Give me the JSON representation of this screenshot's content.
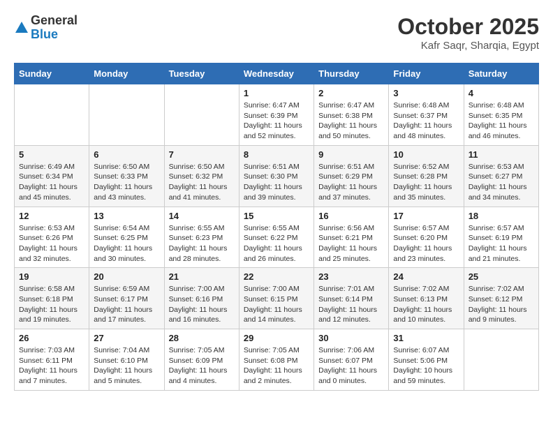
{
  "header": {
    "logo_general": "General",
    "logo_blue": "Blue",
    "month_title": "October 2025",
    "subtitle": "Kafr Saqr, Sharqia, Egypt"
  },
  "weekdays": [
    "Sunday",
    "Monday",
    "Tuesday",
    "Wednesday",
    "Thursday",
    "Friday",
    "Saturday"
  ],
  "weeks": [
    [
      {
        "day": "",
        "content": ""
      },
      {
        "day": "",
        "content": ""
      },
      {
        "day": "",
        "content": ""
      },
      {
        "day": "1",
        "content": "Sunrise: 6:47 AM\nSunset: 6:39 PM\nDaylight: 11 hours\nand 52 minutes."
      },
      {
        "day": "2",
        "content": "Sunrise: 6:47 AM\nSunset: 6:38 PM\nDaylight: 11 hours\nand 50 minutes."
      },
      {
        "day": "3",
        "content": "Sunrise: 6:48 AM\nSunset: 6:37 PM\nDaylight: 11 hours\nand 48 minutes."
      },
      {
        "day": "4",
        "content": "Sunrise: 6:48 AM\nSunset: 6:35 PM\nDaylight: 11 hours\nand 46 minutes."
      }
    ],
    [
      {
        "day": "5",
        "content": "Sunrise: 6:49 AM\nSunset: 6:34 PM\nDaylight: 11 hours\nand 45 minutes."
      },
      {
        "day": "6",
        "content": "Sunrise: 6:50 AM\nSunset: 6:33 PM\nDaylight: 11 hours\nand 43 minutes."
      },
      {
        "day": "7",
        "content": "Sunrise: 6:50 AM\nSunset: 6:32 PM\nDaylight: 11 hours\nand 41 minutes."
      },
      {
        "day": "8",
        "content": "Sunrise: 6:51 AM\nSunset: 6:30 PM\nDaylight: 11 hours\nand 39 minutes."
      },
      {
        "day": "9",
        "content": "Sunrise: 6:51 AM\nSunset: 6:29 PM\nDaylight: 11 hours\nand 37 minutes."
      },
      {
        "day": "10",
        "content": "Sunrise: 6:52 AM\nSunset: 6:28 PM\nDaylight: 11 hours\nand 35 minutes."
      },
      {
        "day": "11",
        "content": "Sunrise: 6:53 AM\nSunset: 6:27 PM\nDaylight: 11 hours\nand 34 minutes."
      }
    ],
    [
      {
        "day": "12",
        "content": "Sunrise: 6:53 AM\nSunset: 6:26 PM\nDaylight: 11 hours\nand 32 minutes."
      },
      {
        "day": "13",
        "content": "Sunrise: 6:54 AM\nSunset: 6:25 PM\nDaylight: 11 hours\nand 30 minutes."
      },
      {
        "day": "14",
        "content": "Sunrise: 6:55 AM\nSunset: 6:23 PM\nDaylight: 11 hours\nand 28 minutes."
      },
      {
        "day": "15",
        "content": "Sunrise: 6:55 AM\nSunset: 6:22 PM\nDaylight: 11 hours\nand 26 minutes."
      },
      {
        "day": "16",
        "content": "Sunrise: 6:56 AM\nSunset: 6:21 PM\nDaylight: 11 hours\nand 25 minutes."
      },
      {
        "day": "17",
        "content": "Sunrise: 6:57 AM\nSunset: 6:20 PM\nDaylight: 11 hours\nand 23 minutes."
      },
      {
        "day": "18",
        "content": "Sunrise: 6:57 AM\nSunset: 6:19 PM\nDaylight: 11 hours\nand 21 minutes."
      }
    ],
    [
      {
        "day": "19",
        "content": "Sunrise: 6:58 AM\nSunset: 6:18 PM\nDaylight: 11 hours\nand 19 minutes."
      },
      {
        "day": "20",
        "content": "Sunrise: 6:59 AM\nSunset: 6:17 PM\nDaylight: 11 hours\nand 17 minutes."
      },
      {
        "day": "21",
        "content": "Sunrise: 7:00 AM\nSunset: 6:16 PM\nDaylight: 11 hours\nand 16 minutes."
      },
      {
        "day": "22",
        "content": "Sunrise: 7:00 AM\nSunset: 6:15 PM\nDaylight: 11 hours\nand 14 minutes."
      },
      {
        "day": "23",
        "content": "Sunrise: 7:01 AM\nSunset: 6:14 PM\nDaylight: 11 hours\nand 12 minutes."
      },
      {
        "day": "24",
        "content": "Sunrise: 7:02 AM\nSunset: 6:13 PM\nDaylight: 11 hours\nand 10 minutes."
      },
      {
        "day": "25",
        "content": "Sunrise: 7:02 AM\nSunset: 6:12 PM\nDaylight: 11 hours\nand 9 minutes."
      }
    ],
    [
      {
        "day": "26",
        "content": "Sunrise: 7:03 AM\nSunset: 6:11 PM\nDaylight: 11 hours\nand 7 minutes."
      },
      {
        "day": "27",
        "content": "Sunrise: 7:04 AM\nSunset: 6:10 PM\nDaylight: 11 hours\nand 5 minutes."
      },
      {
        "day": "28",
        "content": "Sunrise: 7:05 AM\nSunset: 6:09 PM\nDaylight: 11 hours\nand 4 minutes."
      },
      {
        "day": "29",
        "content": "Sunrise: 7:05 AM\nSunset: 6:08 PM\nDaylight: 11 hours\nand 2 minutes."
      },
      {
        "day": "30",
        "content": "Sunrise: 7:06 AM\nSunset: 6:07 PM\nDaylight: 11 hours\nand 0 minutes."
      },
      {
        "day": "31",
        "content": "Sunrise: 6:07 AM\nSunset: 5:06 PM\nDaylight: 10 hours\nand 59 minutes."
      },
      {
        "day": "",
        "content": ""
      }
    ]
  ]
}
